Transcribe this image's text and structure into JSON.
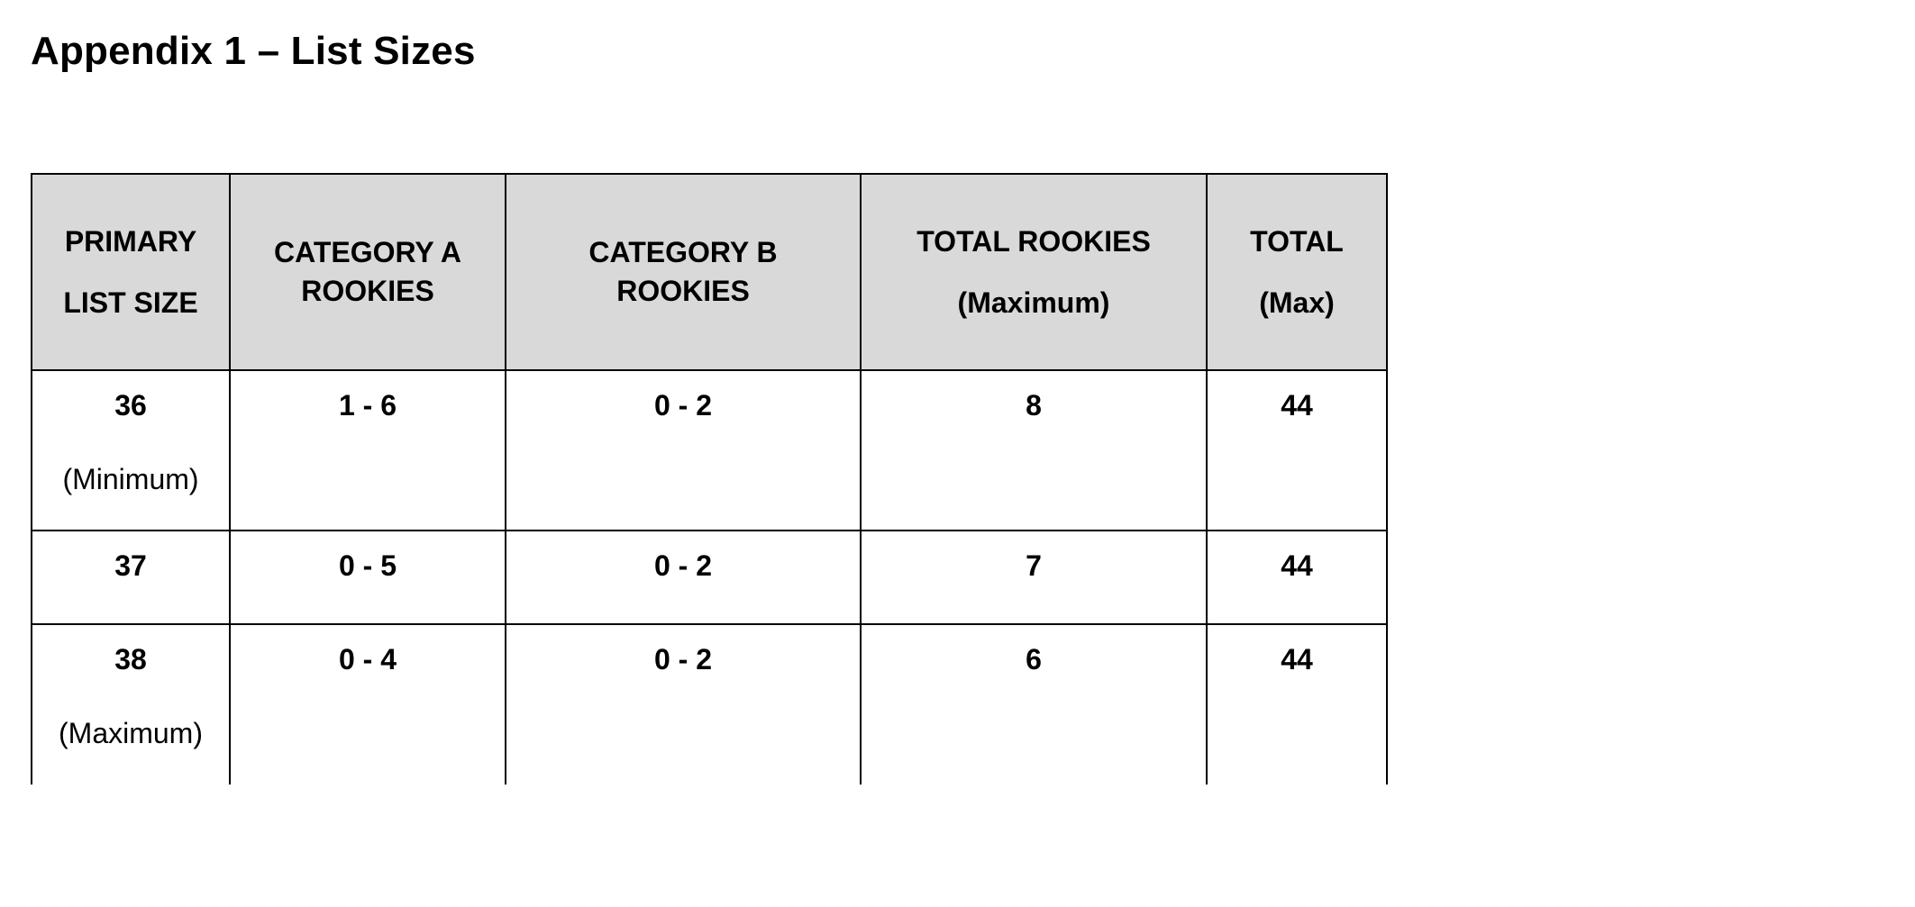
{
  "title": "Appendix 1 – List Sizes",
  "headers": {
    "primary_top": "PRIMARY",
    "primary_bottom": "LIST SIZE",
    "catA_top": "CATEGORY A",
    "catA_bottom": "ROOKIES",
    "catB_top": "CATEGORY B",
    "catB_bottom": "ROOKIES",
    "total_rookies_top": "TOTAL ROOKIES",
    "total_rookies_bottom": "(Maximum)",
    "total_top": "TOTAL",
    "total_bottom": "(Max)"
  },
  "rows": [
    {
      "primary": "36",
      "primary_note": "(Minimum)",
      "catA": "1 - 6",
      "catB": "0 - 2",
      "total_rookies": "8",
      "total": "44"
    },
    {
      "primary": "37",
      "primary_note": "",
      "catA": "0 - 5",
      "catB": "0 - 2",
      "total_rookies": "7",
      "total": "44"
    },
    {
      "primary": "38",
      "primary_note": "(Maximum)",
      "catA": "0 - 4",
      "catB": "0 - 2",
      "total_rookies": "6",
      "total": "44"
    }
  ]
}
